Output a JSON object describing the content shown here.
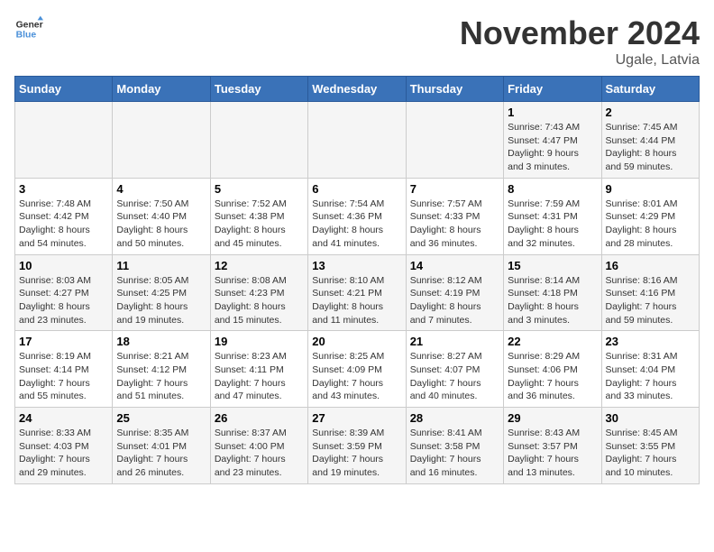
{
  "header": {
    "logo_general": "General",
    "logo_blue": "Blue",
    "month_title": "November 2024",
    "location": "Ugale, Latvia"
  },
  "weekdays": [
    "Sunday",
    "Monday",
    "Tuesday",
    "Wednesday",
    "Thursday",
    "Friday",
    "Saturday"
  ],
  "weeks": [
    [
      {
        "day": "",
        "info": ""
      },
      {
        "day": "",
        "info": ""
      },
      {
        "day": "",
        "info": ""
      },
      {
        "day": "",
        "info": ""
      },
      {
        "day": "",
        "info": ""
      },
      {
        "day": "1",
        "info": "Sunrise: 7:43 AM\nSunset: 4:47 PM\nDaylight: 9 hours\nand 3 minutes."
      },
      {
        "day": "2",
        "info": "Sunrise: 7:45 AM\nSunset: 4:44 PM\nDaylight: 8 hours\nand 59 minutes."
      }
    ],
    [
      {
        "day": "3",
        "info": "Sunrise: 7:48 AM\nSunset: 4:42 PM\nDaylight: 8 hours\nand 54 minutes."
      },
      {
        "day": "4",
        "info": "Sunrise: 7:50 AM\nSunset: 4:40 PM\nDaylight: 8 hours\nand 50 minutes."
      },
      {
        "day": "5",
        "info": "Sunrise: 7:52 AM\nSunset: 4:38 PM\nDaylight: 8 hours\nand 45 minutes."
      },
      {
        "day": "6",
        "info": "Sunrise: 7:54 AM\nSunset: 4:36 PM\nDaylight: 8 hours\nand 41 minutes."
      },
      {
        "day": "7",
        "info": "Sunrise: 7:57 AM\nSunset: 4:33 PM\nDaylight: 8 hours\nand 36 minutes."
      },
      {
        "day": "8",
        "info": "Sunrise: 7:59 AM\nSunset: 4:31 PM\nDaylight: 8 hours\nand 32 minutes."
      },
      {
        "day": "9",
        "info": "Sunrise: 8:01 AM\nSunset: 4:29 PM\nDaylight: 8 hours\nand 28 minutes."
      }
    ],
    [
      {
        "day": "10",
        "info": "Sunrise: 8:03 AM\nSunset: 4:27 PM\nDaylight: 8 hours\nand 23 minutes."
      },
      {
        "day": "11",
        "info": "Sunrise: 8:05 AM\nSunset: 4:25 PM\nDaylight: 8 hours\nand 19 minutes."
      },
      {
        "day": "12",
        "info": "Sunrise: 8:08 AM\nSunset: 4:23 PM\nDaylight: 8 hours\nand 15 minutes."
      },
      {
        "day": "13",
        "info": "Sunrise: 8:10 AM\nSunset: 4:21 PM\nDaylight: 8 hours\nand 11 minutes."
      },
      {
        "day": "14",
        "info": "Sunrise: 8:12 AM\nSunset: 4:19 PM\nDaylight: 8 hours\nand 7 minutes."
      },
      {
        "day": "15",
        "info": "Sunrise: 8:14 AM\nSunset: 4:18 PM\nDaylight: 8 hours\nand 3 minutes."
      },
      {
        "day": "16",
        "info": "Sunrise: 8:16 AM\nSunset: 4:16 PM\nDaylight: 7 hours\nand 59 minutes."
      }
    ],
    [
      {
        "day": "17",
        "info": "Sunrise: 8:19 AM\nSunset: 4:14 PM\nDaylight: 7 hours\nand 55 minutes."
      },
      {
        "day": "18",
        "info": "Sunrise: 8:21 AM\nSunset: 4:12 PM\nDaylight: 7 hours\nand 51 minutes."
      },
      {
        "day": "19",
        "info": "Sunrise: 8:23 AM\nSunset: 4:11 PM\nDaylight: 7 hours\nand 47 minutes."
      },
      {
        "day": "20",
        "info": "Sunrise: 8:25 AM\nSunset: 4:09 PM\nDaylight: 7 hours\nand 43 minutes."
      },
      {
        "day": "21",
        "info": "Sunrise: 8:27 AM\nSunset: 4:07 PM\nDaylight: 7 hours\nand 40 minutes."
      },
      {
        "day": "22",
        "info": "Sunrise: 8:29 AM\nSunset: 4:06 PM\nDaylight: 7 hours\nand 36 minutes."
      },
      {
        "day": "23",
        "info": "Sunrise: 8:31 AM\nSunset: 4:04 PM\nDaylight: 7 hours\nand 33 minutes."
      }
    ],
    [
      {
        "day": "24",
        "info": "Sunrise: 8:33 AM\nSunset: 4:03 PM\nDaylight: 7 hours\nand 29 minutes."
      },
      {
        "day": "25",
        "info": "Sunrise: 8:35 AM\nSunset: 4:01 PM\nDaylight: 7 hours\nand 26 minutes."
      },
      {
        "day": "26",
        "info": "Sunrise: 8:37 AM\nSunset: 4:00 PM\nDaylight: 7 hours\nand 23 minutes."
      },
      {
        "day": "27",
        "info": "Sunrise: 8:39 AM\nSunset: 3:59 PM\nDaylight: 7 hours\nand 19 minutes."
      },
      {
        "day": "28",
        "info": "Sunrise: 8:41 AM\nSunset: 3:58 PM\nDaylight: 7 hours\nand 16 minutes."
      },
      {
        "day": "29",
        "info": "Sunrise: 8:43 AM\nSunset: 3:57 PM\nDaylight: 7 hours\nand 13 minutes."
      },
      {
        "day": "30",
        "info": "Sunrise: 8:45 AM\nSunset: 3:55 PM\nDaylight: 7 hours\nand 10 minutes."
      }
    ]
  ]
}
